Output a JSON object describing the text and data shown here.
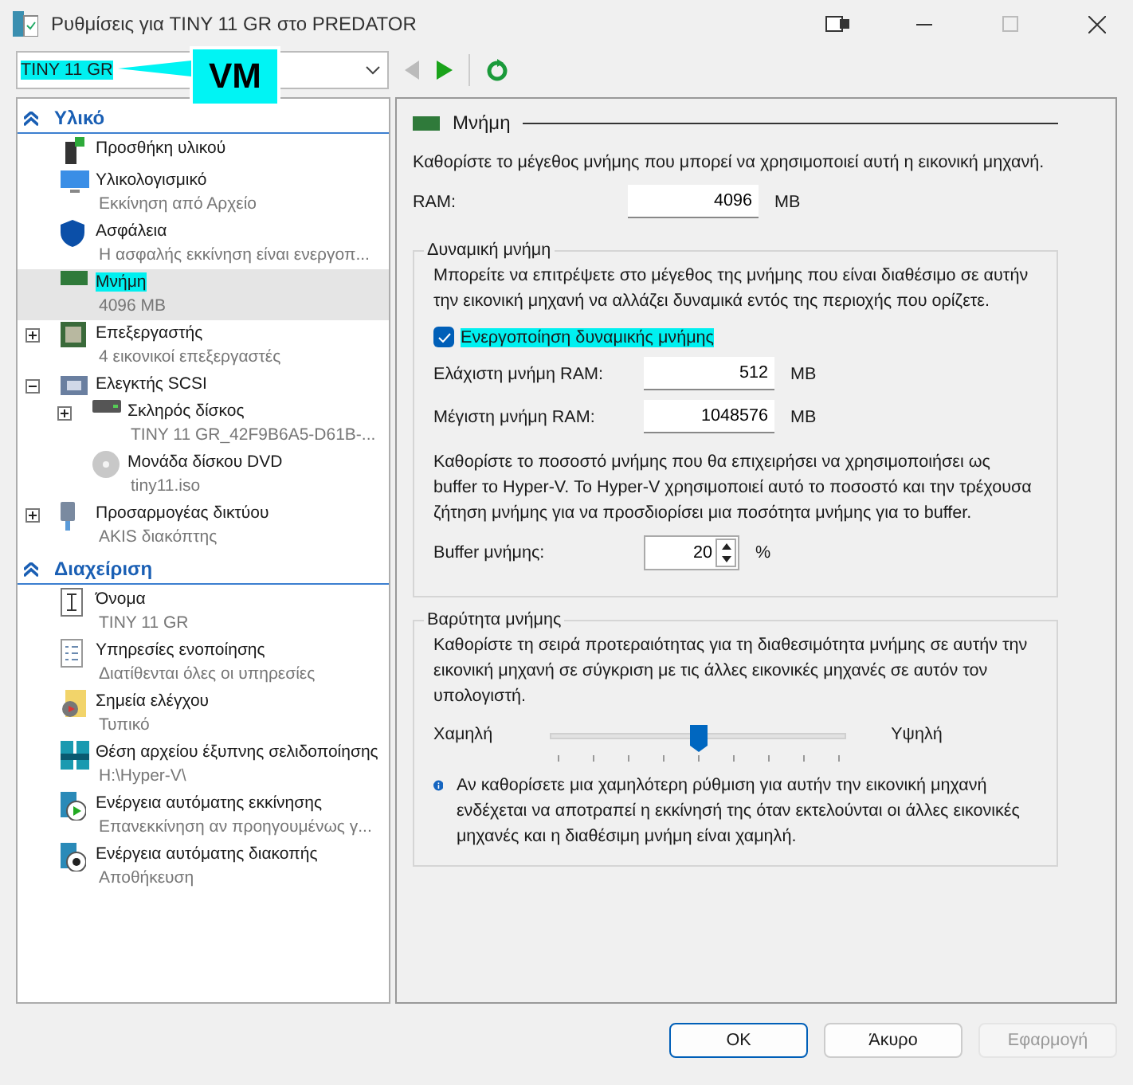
{
  "window": {
    "title": "Ρυθμίσεις για TINY 11 GR στο PREDATOR"
  },
  "vm_selector": {
    "value": "TINY 11 GR",
    "highlighted": true
  },
  "callout": {
    "text": "VM"
  },
  "navigation": {
    "back_disabled": true
  },
  "sections": [
    {
      "title": "Υλικό",
      "items": [
        {
          "title": "Προσθήκη υλικού",
          "selected": false,
          "highlighted": false
        },
        {
          "title": "Υλικολογισμικό",
          "subtitle": "Εκκίνηση από Αρχείο",
          "selected": false,
          "highlighted": false
        },
        {
          "title": "Ασφάλεια",
          "subtitle": "Η ασφαλής εκκίνηση είναι ενεργοπ...",
          "selected": false,
          "highlighted": false
        },
        {
          "title": "Μνήμη",
          "subtitle": "4096 MB",
          "selected": true,
          "highlighted": true
        },
        {
          "title": "Επεξεργαστής",
          "subtitle": "4 εικονικοί επεξεργαστές",
          "selected": false,
          "highlighted": false,
          "expanded": false
        },
        {
          "title": "Ελεγκτής SCSI",
          "selected": false,
          "highlighted": false,
          "expanded": true,
          "children": [
            {
              "title": "Σκληρός δίσκος",
              "subtitle": "TINY 11 GR_42F9B6A5-D61B-...",
              "selected": false,
              "highlighted": false,
              "expanded": false
            },
            {
              "title": "Μονάδα δίσκου DVD",
              "subtitle": "tiny11.iso",
              "selected": false,
              "highlighted": false
            }
          ]
        },
        {
          "title": "Προσαρμογέας δικτύου",
          "subtitle": "AKIS διακόπτης",
          "selected": false,
          "highlighted": false,
          "expanded": false
        }
      ]
    },
    {
      "title": "Διαχείριση",
      "items": [
        {
          "title": "Όνομα",
          "subtitle": "TINY 11 GR",
          "selected": false,
          "highlighted": false
        },
        {
          "title": "Υπηρεσίες ενοποίησης",
          "subtitle": "Διατίθενται όλες οι υπηρεσίες",
          "selected": false,
          "highlighted": false
        },
        {
          "title": "Σημεία ελέγχου",
          "subtitle": "Τυπικό",
          "selected": false,
          "highlighted": false
        },
        {
          "title": "Θέση αρχείου έξυπνης σελιδοποίησης",
          "subtitle": "H:\\Hyper-V\\",
          "selected": false,
          "highlighted": false
        },
        {
          "title": "Ενέργεια αυτόματης εκκίνησης",
          "subtitle": "Επανεκκίνηση αν προηγουμένως γ...",
          "selected": false,
          "highlighted": false
        },
        {
          "title": "Ενέργεια αυτόματης διακοπής",
          "subtitle": "Αποθήκευση",
          "selected": false,
          "highlighted": false
        }
      ]
    }
  ],
  "memory": {
    "heading": "Μνήμη",
    "intro": "Καθορίστε το μέγεθος μνήμης που μπορεί να χρησιμοποιεί αυτή η εικονική μηχανή.",
    "ram": {
      "label": "RAM:",
      "value": "4096",
      "unit": "MB"
    },
    "dynamic": {
      "legend": "Δυναμική μνήμη",
      "text": "Μπορείτε να επιτρέψετε στο μέγεθος της μνήμης που είναι διαθέσιμο σε αυτήν την εικονική μηχανή να αλλάζει δυναμικά εντός της περιοχής που ορίζετε.",
      "checkbox": {
        "label": "Ενεργοποίηση δυναμικής μνήμης",
        "checked": true,
        "highlighted": true
      },
      "min": {
        "label": "Ελάχιστη μνήμη RAM:",
        "value": "512",
        "unit": "MB"
      },
      "max": {
        "label": "Μέγιστη μνήμη RAM:",
        "value": "1048576",
        "unit": "MB"
      },
      "buffer_text": "Καθορίστε το ποσοστό μνήμης που θα επιχειρήσει να χρησιμοποιήσει ως buffer το Hyper-V. Το Hyper-V χρησιμοποιεί αυτό το ποσοστό και την τρέχουσα ζήτηση μνήμης για να προσδιορίσει μια ποσότητα μνήμης για το buffer.",
      "buffer": {
        "label": "Buffer μνήμης:",
        "value": "20",
        "unit": "%"
      }
    },
    "weight": {
      "legend": "Βαρύτητα μνήμης",
      "text": "Καθορίστε τη σειρά προτεραιότητας για τη διαθεσιμότητα μνήμης σε αυτήν την εικονική μηχανή σε σύγκριση με τις άλλες εικονικές μηχανές σε αυτόν τον υπολογιστή.",
      "low": "Χαμηλή",
      "high": "Υψηλή",
      "level": 0.5,
      "info": "Αν καθορίσετε μια χαμηλότερη ρύθμιση για αυτήν την εικονική μηχανή ενδέχεται να αποτραπεί η εκκίνησή της όταν εκτελούνται οι άλλες εικονικές μηχανές και η διαθέσιμη μνήμη είναι χαμηλή."
    }
  },
  "buttons": [
    {
      "label": "OK",
      "default": true,
      "disabled": false
    },
    {
      "label": "Άκυρο",
      "default": false,
      "disabled": false
    },
    {
      "label": "Εφαρμογή",
      "default": false,
      "disabled": true
    }
  ]
}
